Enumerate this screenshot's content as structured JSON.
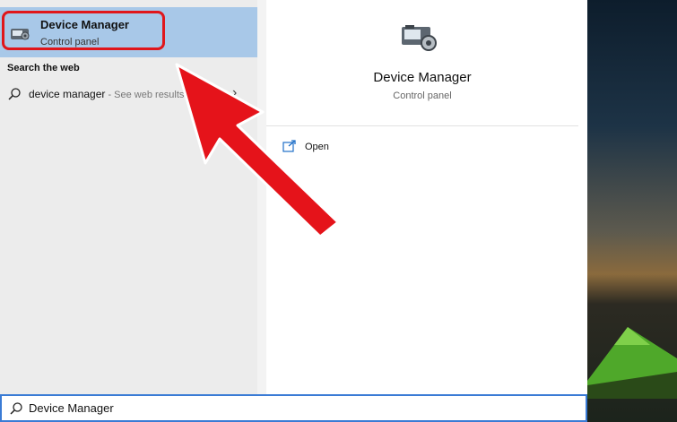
{
  "best_match": {
    "title": "Device Manager",
    "subtitle": "Control panel"
  },
  "web_section": {
    "heading": "Search the web",
    "query": "device manager",
    "hint": " - See web results"
  },
  "preview": {
    "title": "Device Manager",
    "subtitle": "Control panel",
    "actions": [
      {
        "label": "Open",
        "icon": "open-icon"
      }
    ]
  },
  "search": {
    "value": "Device Manager"
  },
  "colors": {
    "highlight": "#e0161b",
    "selected_bg": "#a8c8e8",
    "search_border": "#3a7bd5"
  }
}
